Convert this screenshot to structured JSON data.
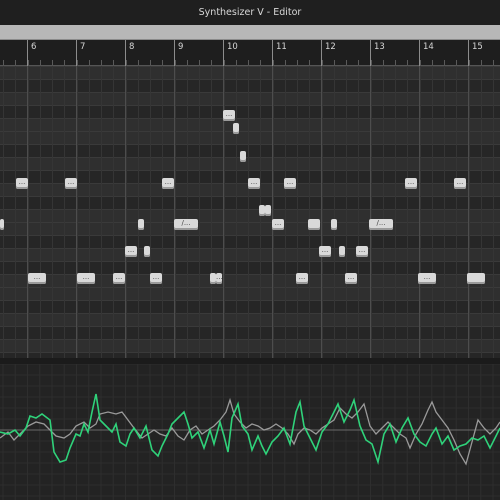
{
  "window": {
    "title": "Synthesizer V - Editor"
  },
  "ruler": {
    "bars": [
      "6",
      "7",
      "8",
      "9",
      "10",
      "11",
      "12",
      "13",
      "14",
      "15"
    ]
  },
  "notes": [
    {
      "lyric": "..."
    },
    {
      "lyric": ""
    },
    {
      "lyric": ""
    },
    {
      "lyric": "..."
    },
    {
      "lyric": "..."
    },
    {
      "lyric": "..."
    },
    {
      "lyric": "..."
    },
    {
      "lyric": "..."
    },
    {
      "lyric": "..."
    },
    {
      "lyric": "..."
    },
    {
      "lyric": ""
    },
    {
      "lyric": ""
    },
    {
      "lyric": ""
    },
    {
      "lyric": ""
    },
    {
      "lyric": "/..."
    },
    {
      "lyric": "..."
    },
    {
      "lyric": ""
    },
    {
      "lyric": ""
    },
    {
      "lyric": "/..."
    },
    {
      "lyric": "..."
    },
    {
      "lyric": ""
    },
    {
      "lyric": "..."
    },
    {
      "lyric": ""
    },
    {
      "lyric": "..."
    },
    {
      "lyric": "..."
    },
    {
      "lyric": "..."
    },
    {
      "lyric": "..."
    },
    {
      "lyric": "..."
    },
    {
      "lyric": ""
    },
    {
      "lyric": "..."
    },
    {
      "lyric": "..."
    },
    {
      "lyric": "..."
    },
    {
      "lyric": "..."
    }
  ],
  "colors": {
    "pitch_curve": "#2fd27a",
    "reference_curve": "#9a9a9a"
  }
}
